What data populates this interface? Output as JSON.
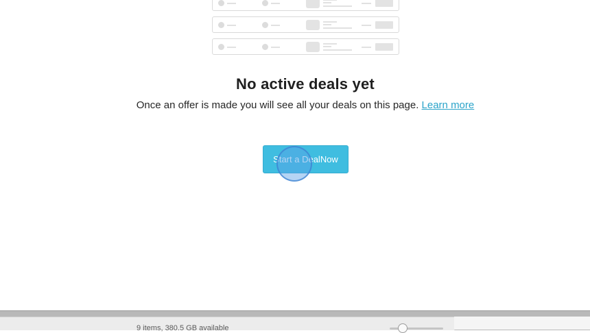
{
  "empty_state": {
    "title": "No active deals yet",
    "message": "Once an offer is made you will see all your deals on this page.",
    "learn_more_label": "Learn more",
    "cta_label": "Start a DealNow"
  },
  "status_bar": {
    "text": "9 items, 380.5 GB available"
  },
  "colors": {
    "accent": "#3fbde0",
    "link": "#2aa3c9"
  }
}
